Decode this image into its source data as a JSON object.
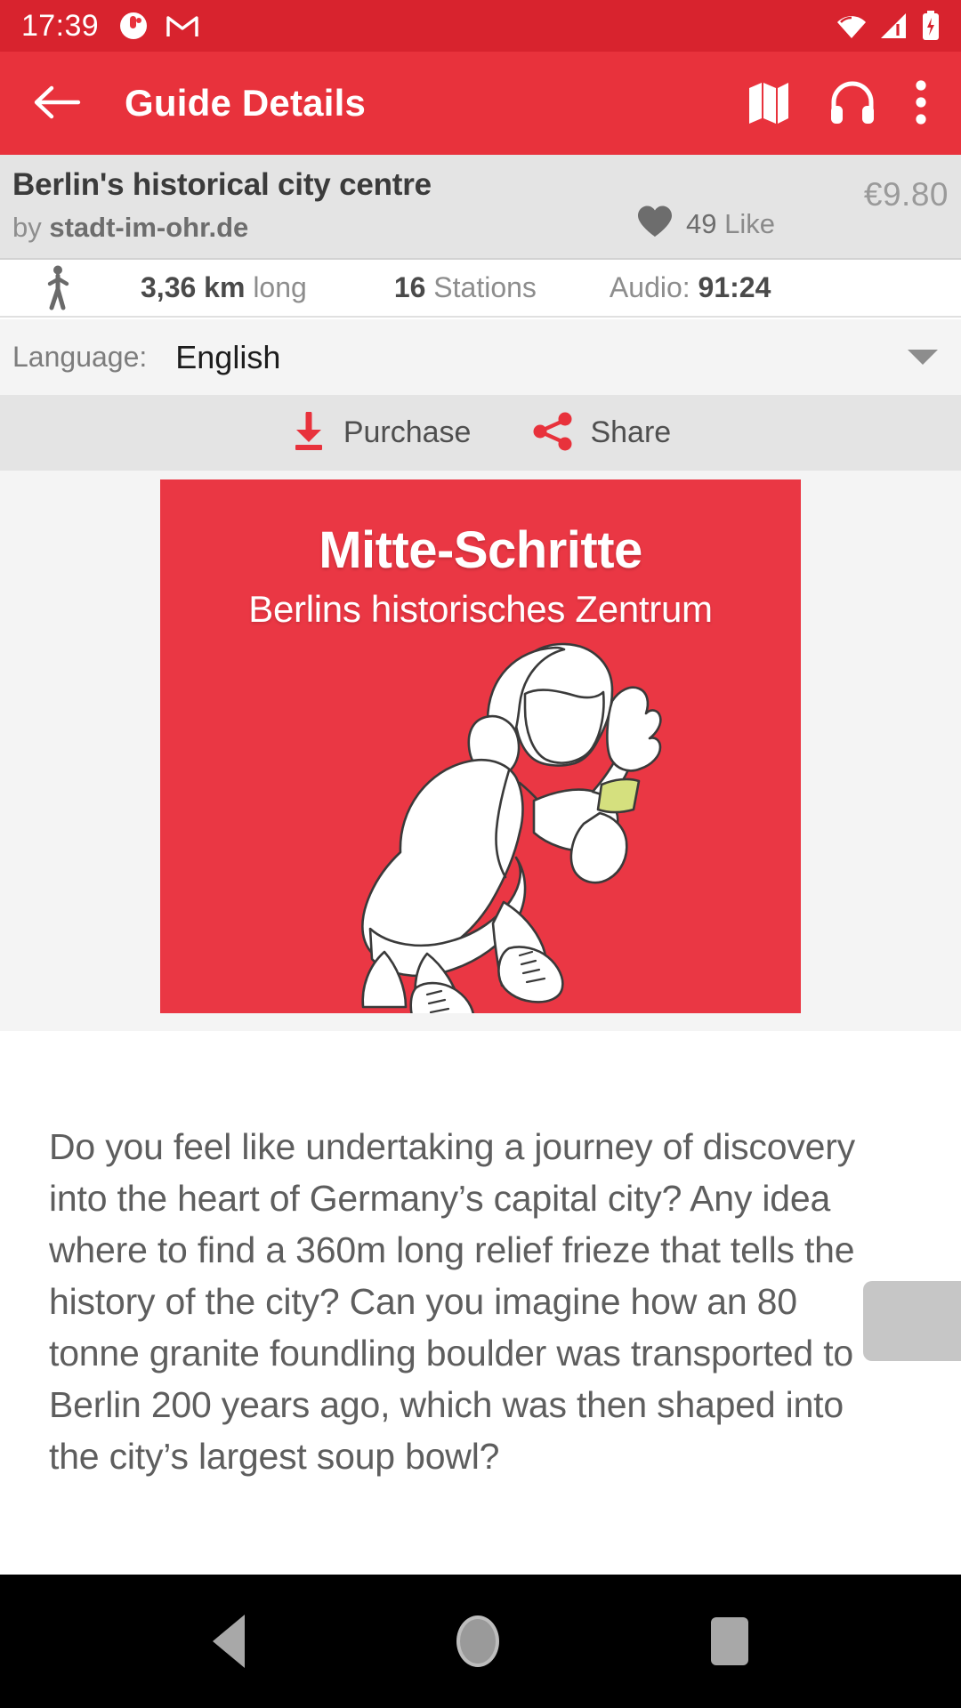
{
  "status_bar": {
    "time": "17:39",
    "left_icons": [
      "clock-app-icon",
      "gmail-icon"
    ],
    "right_icons": [
      "wifi-icon",
      "cellular-signal-icon",
      "battery-charging-icon"
    ],
    "background_color": "#d8232e"
  },
  "app_bar": {
    "back_icon": "arrow-left-icon",
    "title": "Guide Details",
    "actions": [
      "map-icon",
      "headphones-icon",
      "overflow-menu-icon"
    ],
    "background_color": "#e8323c"
  },
  "guide": {
    "title": "Berlin's historical city centre",
    "by_prefix": "by ",
    "author": "stadt-im-ohr.de",
    "like_icon": "heart-icon",
    "like_count": "49",
    "like_label": "Like",
    "price": "€9.80"
  },
  "stats": {
    "mode_icon": "walking-person-icon",
    "distance_value": "3,36 km",
    "distance_label": "long",
    "stations_value": "16",
    "stations_label": "Stations",
    "audio_label": "Audio:",
    "audio_value": "91:24"
  },
  "language": {
    "label": "Language:",
    "value": "English",
    "caret_icon": "chevron-down-icon"
  },
  "actions": {
    "purchase_icon": "download-icon",
    "purchase_label": "Purchase",
    "share_icon": "share-icon",
    "share_label": "Share",
    "accent_color": "#e8323c"
  },
  "cover": {
    "title": "Mitte-Schritte",
    "subtitle": "Berlins historisches Zentrum",
    "background_color": "#ea3744",
    "artwork": "crouching-person-with-headphones-illustration",
    "wristband_color": "#d5e07e"
  },
  "description": {
    "text": "Do you feel like undertaking a journey of discovery into the heart of Germany’s capital city? Any idea where to find a 360m long relief frieze that tells the history of the city? Can you imagine how an 80 tonne granite foundling boulder was transported to Berlin 200 years ago, which was then shaped into the city’s largest soup bowl?"
  },
  "nav_bar": {
    "back": "back-triangle-icon",
    "home": "home-circle-icon",
    "recents": "recents-square-icon"
  }
}
